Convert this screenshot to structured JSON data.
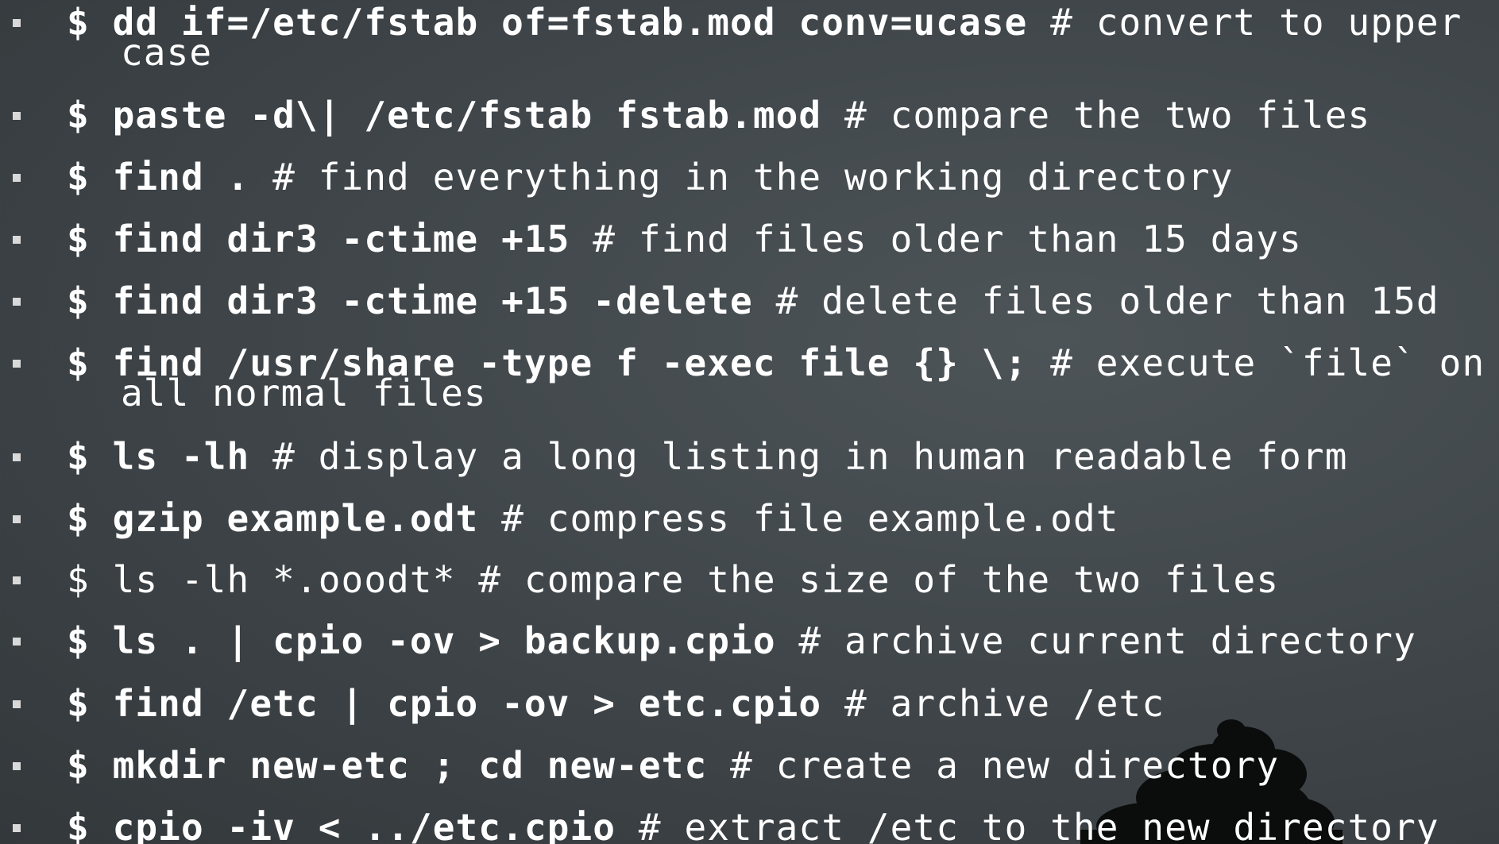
{
  "items": [
    {
      "cmd": "$ dd if=/etc/fstab of=fstab.mod conv=ucase",
      "comment": " # convert to upper",
      "comment_cont": "case"
    },
    {
      "cmd": "$ paste -d\\| /etc/fstab fstab.mod",
      "comment": " # compare the two files"
    },
    {
      "cmd": "$ find .",
      "comment": " # find everything in the working directory"
    },
    {
      "cmd": "$ find dir3 -ctime +15",
      "comment": " # find files older than 15 days"
    },
    {
      "cmd": "$ find dir3 -ctime +15 -delete",
      "comment": " # delete files older than 15d"
    },
    {
      "cmd": "$ find /usr/share -type f -exec file {} \\;",
      "comment": " # execute `file` on",
      "comment_cont": "all normal files"
    },
    {
      "cmd": "$ ls -lh",
      "comment": " # display a long listing in human readable form"
    },
    {
      "cmd": "$ gzip example.odt",
      "comment": " # compress file example.odt"
    },
    {
      "cmd": "$ ls -lh *.ooodt*",
      "comment": " # compare the size of the two files",
      "plain": true
    },
    {
      "cmd": "$ ls . | cpio -ov > backup.cpio",
      "comment": " # archive current directory"
    },
    {
      "cmd": "$ find /etc | cpio -ov > etc.cpio",
      "comment": " # archive /etc"
    },
    {
      "cmd": "$ mkdir new-etc ; cd new-etc",
      "comment": " # create a new directory"
    },
    {
      "cmd": "$ cpio -iv < ../etc.cpio",
      "comment": " # extract /etc to the new directory"
    }
  ]
}
